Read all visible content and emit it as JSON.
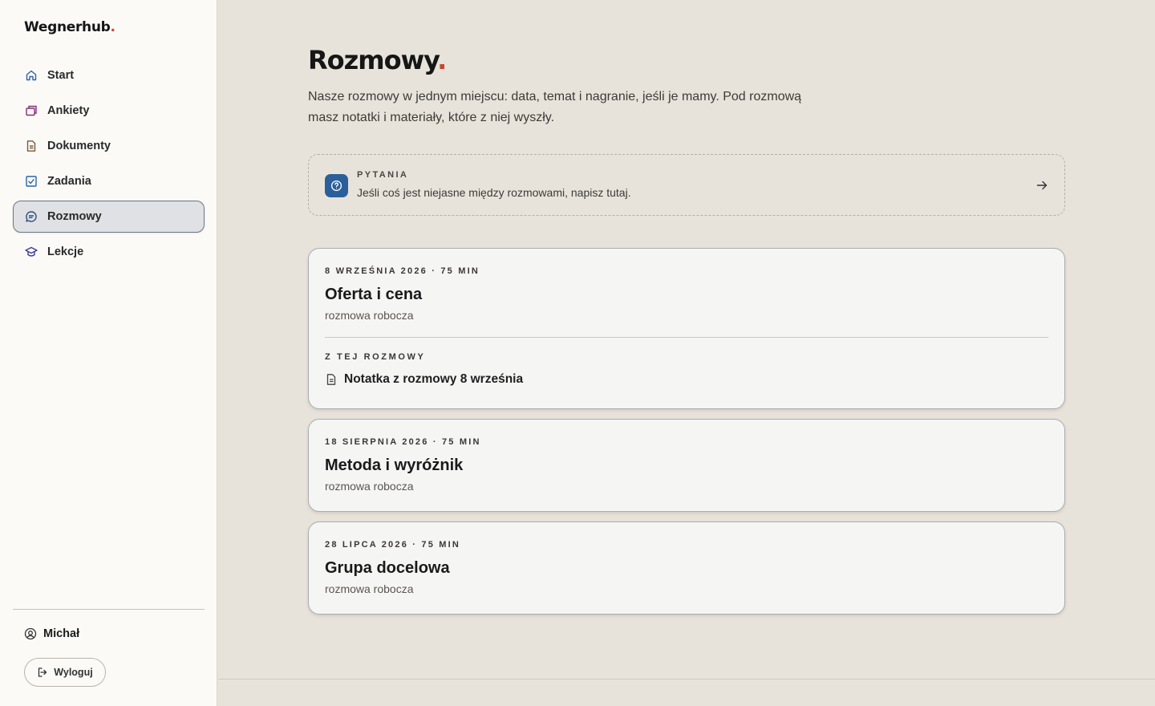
{
  "brand": {
    "name": "Wegnerhub",
    "dot": "."
  },
  "sidebar": {
    "items": [
      {
        "label": "Start",
        "icon": "home-icon",
        "active": false
      },
      {
        "label": "Ankiety",
        "icon": "survey-icon",
        "active": false
      },
      {
        "label": "Dokumenty",
        "icon": "document-icon",
        "active": false
      },
      {
        "label": "Zadania",
        "icon": "checkbox-icon",
        "active": false
      },
      {
        "label": "Rozmowy",
        "icon": "chat-icon",
        "active": true
      },
      {
        "label": "Lekcje",
        "icon": "graduation-cap-icon",
        "active": false
      }
    ],
    "user": {
      "name": "Michał",
      "icon": "user-circle-icon"
    },
    "logout_label": "Wyloguj"
  },
  "page": {
    "title": "Rozmowy",
    "title_dot": ".",
    "intro": "Nasze rozmowy w jednym miejscu: data, temat i nagranie, jeśli je mamy. Pod rozmową masz notatki i materiały, które z niej wyszły.",
    "question": {
      "heading": "PYTANIA",
      "text": "Jeśli coś jest niejasne między rozmowami, napisz tutaj.",
      "icon": "question-circle-icon"
    }
  },
  "conversations": [
    {
      "meta": "8 WRZEŚNIA 2026 · 75 MIN",
      "title": "Oferta i cena",
      "subtitle": "rozmowa robocza",
      "from_heading": "Z TEJ ROZMOWY",
      "note": "Notatka z rozmowy 8 września"
    },
    {
      "meta": "18 SIERPNIA 2026 · 75 MIN",
      "title": "Metoda i wyróżnik",
      "subtitle": "rozmowa robocza"
    },
    {
      "meta": "28 LIPCA 2026 · 75 MIN",
      "title": "Grupa docelowa",
      "subtitle": "rozmowa robocza"
    }
  ],
  "colors": {
    "accent_dot": "#c8462b",
    "question_icon_bg": "#2a5f9a",
    "nav_icon_blue": "#2b63a7",
    "nav_icon_purple": "#5a3fa0"
  }
}
